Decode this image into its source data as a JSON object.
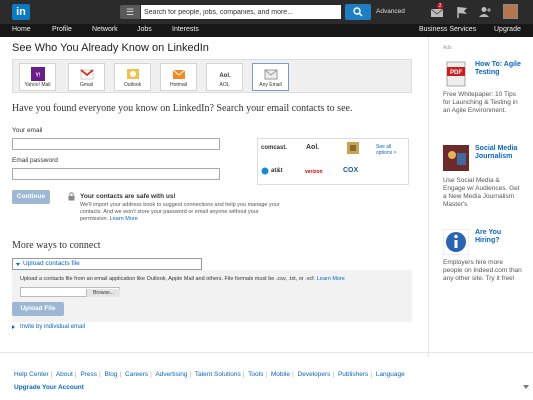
{
  "topbar": {
    "logo": "in",
    "search_placeholder": "Search for people, jobs, companies, and more...",
    "advanced": "Advanced",
    "notification_count": "2"
  },
  "nav": {
    "items": [
      "Home",
      "Profile",
      "Network",
      "Jobs",
      "Interests"
    ],
    "business_services": "Business Services",
    "upgrade": "Upgrade"
  },
  "page": {
    "title": "See Who You Already Know on LinkedIn",
    "providers": [
      "Yahoo! Mail",
      "Gmail",
      "Outlook",
      "Hotmail",
      "AOL",
      "Any Email"
    ],
    "question": "Have you found everyone you know on LinkedIn? Search your email contacts to see.",
    "email_label": "Your email",
    "password_label": "Email password",
    "continue_label": "Continue",
    "safe_title": "Your contacts are safe with us!",
    "safe_text": "We'll import your address book to suggest connections and help you manage your contacts. And we won't store your password or email anyone without your permission.",
    "learn_more": "Learn More",
    "webmail": [
      "comcast.",
      "Aol.",
      "at&t",
      "verizon",
      "COX"
    ],
    "see_all": "See all options >",
    "more_ways_title": "More ways to connect",
    "upload_header": "Upload contacts file",
    "upload_text": "Upload a contacts file from an email application like Outlook, Apple Mail and others. File formats must be .csv, .txt, or .vcf.",
    "upload_learn_more": "Learn More",
    "browse": "Browse...",
    "upload_button": "Upload File",
    "invite": "Invite by individual email"
  },
  "ads": {
    "label": "Ads",
    "items": [
      {
        "title": "How To: Agile Testing",
        "body": "Free Whitepaper: 10 Tips for Launching & Testing in an Agile Environment."
      },
      {
        "title": "Social Media Journalism",
        "body": "Use Social Media & Engage w/ Audiences. Get a New Media Journalism Master's"
      },
      {
        "title": "Are You Hiring?",
        "body": "Employers hire more people on Indeed.com than any other site. Try it free!"
      }
    ]
  },
  "footer": {
    "links": [
      "Help Center",
      "About",
      "Press",
      "Blog",
      "Careers",
      "Advertising",
      "Talent Solutions",
      "Tools",
      "Mobile",
      "Developers",
      "Publishers",
      "Language"
    ],
    "upgrade": "Upgrade Your Account"
  },
  "colors": {
    "brand": "#0a7bc1",
    "link": "#0a66c2",
    "topbar": "#2b2b2b",
    "button_disabled": "#9db8d4"
  }
}
